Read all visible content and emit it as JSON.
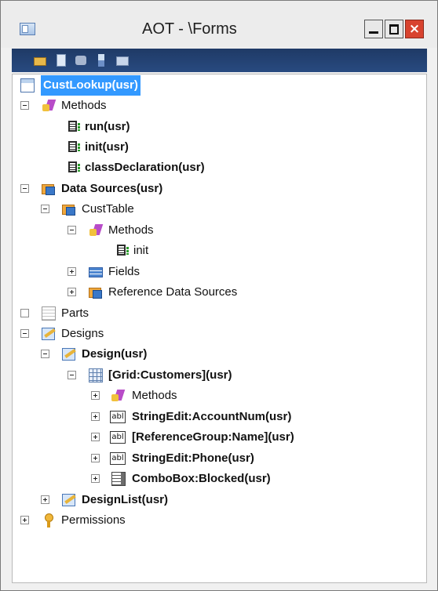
{
  "window": {
    "title": "AOT - \\Forms"
  },
  "toolbar": {
    "icons": [
      "open-icon",
      "properties-icon",
      "compile-icon",
      "filter-icon",
      "import-icon"
    ]
  },
  "tree": {
    "root": "CustLookup(usr)",
    "methods": "Methods",
    "run": "run(usr)",
    "init_usr": "init(usr)",
    "class_declaration": "classDeclaration(usr)",
    "data_sources": "Data Sources(usr)",
    "cust_table": "CustTable",
    "cust_table_methods": "Methods",
    "init": "init",
    "fields": "Fields",
    "reference_data_sources": "Reference Data Sources",
    "parts": "Parts",
    "designs": "Designs",
    "design": "Design(usr)",
    "grid": "[Grid:Customers](usr)",
    "grid_methods": "Methods",
    "account_num": "StringEdit:AccountNum(usr)",
    "reference_group": "[ReferenceGroup:Name](usr)",
    "phone": "StringEdit:Phone(usr)",
    "blocked": "ComboBox:Blocked(usr)",
    "design_list": "DesignList(usr)",
    "permissions": "Permissions"
  },
  "icons": {
    "stringedit_text": "abl"
  },
  "colors": {
    "selection": "#3399ff",
    "toolbar": "#284a80",
    "close_button": "#d8432f"
  }
}
